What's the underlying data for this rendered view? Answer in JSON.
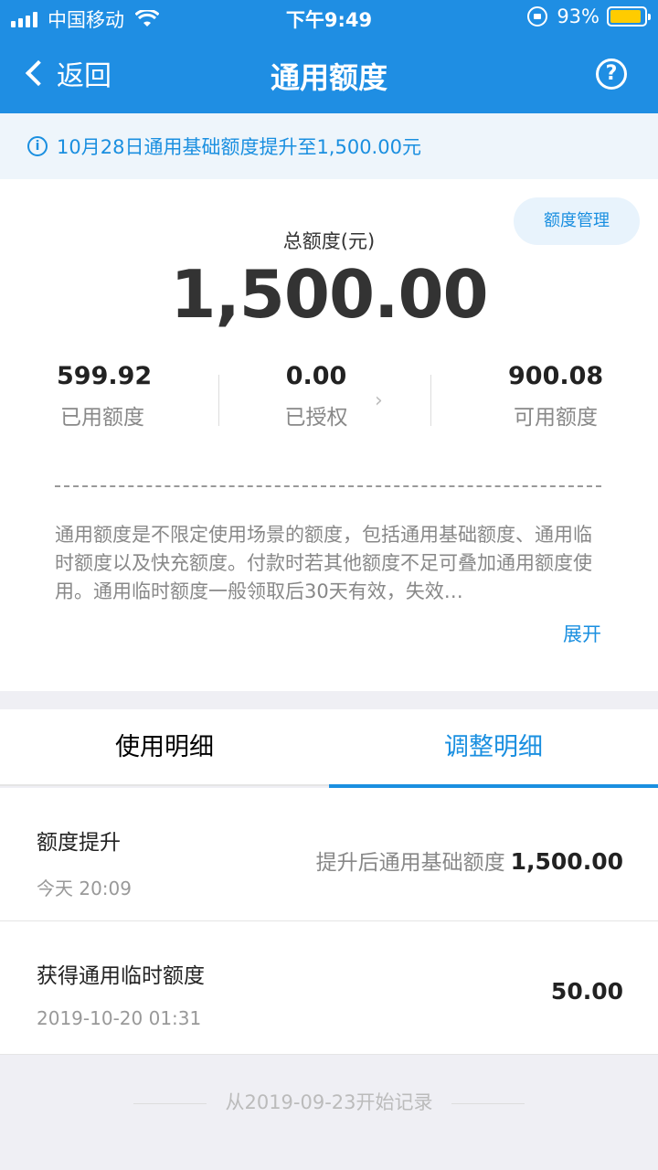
{
  "status_bar": {
    "carrier": "中国移动",
    "time": "下午9:49",
    "battery": "93%"
  },
  "nav": {
    "back_label": "返回",
    "title": "通用额度",
    "help_symbol": "?"
  },
  "notice": {
    "text": "10月28日通用基础额度提升至1,500.00元",
    "icon_symbol": "i"
  },
  "summary": {
    "manage_button": "额度管理",
    "total_label": "总额度(元)",
    "total_value": "1,500.00",
    "stats": [
      {
        "value": "599.92",
        "label": "已用额度"
      },
      {
        "value": "0.00",
        "label": "已授权"
      },
      {
        "value": "900.08",
        "label": "可用额度"
      }
    ],
    "arrow_symbol": "›",
    "description": "通用额度是不限定使用场景的额度，包括通用基础额度、通用临时额度以及快充额度。付款时若其他额度不足可叠加通用额度使用。通用临时额度一般领取后30天有效，失效…",
    "expand_label": "展开"
  },
  "tabs": [
    {
      "label": "使用明细",
      "active": false
    },
    {
      "label": "调整明细",
      "active": true
    }
  ],
  "records": [
    {
      "title": "额度提升",
      "time": "今天 20:09",
      "note": "提升后通用基础额度",
      "amount": "1,500.00"
    },
    {
      "title": "获得通用临时额度",
      "time": "2019-10-20 01:31",
      "note": "",
      "amount": "50.00"
    }
  ],
  "footer": {
    "text": "从2019-09-23开始记录"
  },
  "colors": {
    "brand_blue": "#1f8ee3",
    "accent_blue": "#1a8fe0",
    "battery_yellow": "#ffcc00"
  }
}
